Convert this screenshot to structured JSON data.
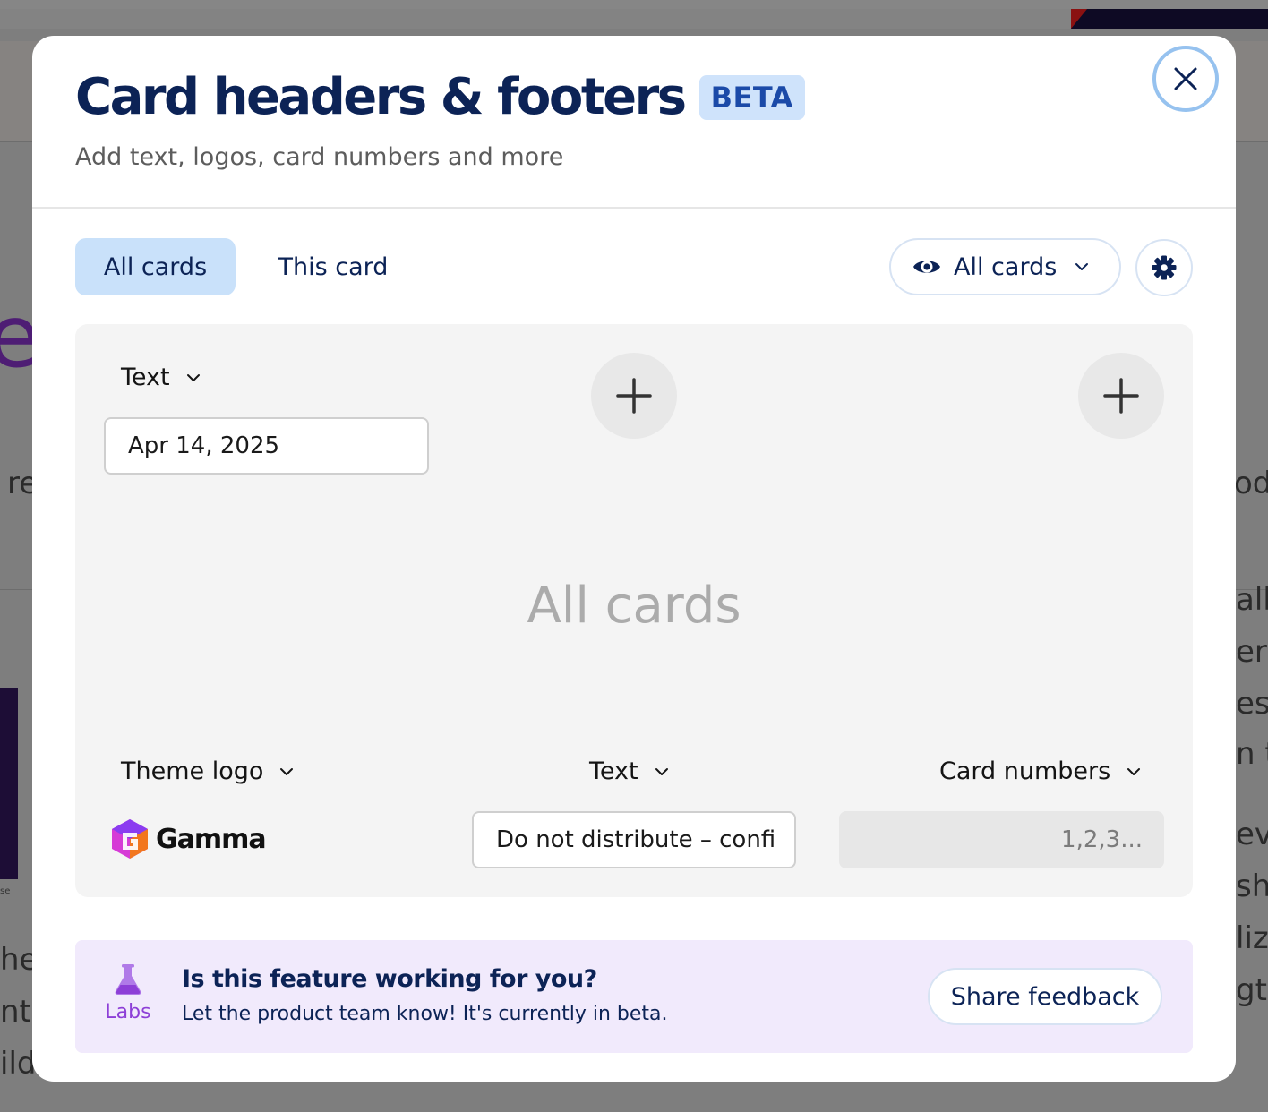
{
  "background": {
    "fragments": [
      "re",
      "od",
      "all",
      "er e",
      "es v",
      "n t",
      "eve",
      "ship",
      "lize",
      "gth",
      "he",
      "nt,",
      "ild"
    ],
    "tiny_text": "se"
  },
  "modal": {
    "title": "Card headers & footers",
    "badge": "BETA",
    "subtitle": "Add text, logos, card numbers and more",
    "close_icon": "close-icon"
  },
  "tabs": [
    {
      "label": "All cards",
      "selected": true
    },
    {
      "label": "This card",
      "selected": false
    }
  ],
  "view_select": {
    "icon": "eye-icon",
    "value": "All cards"
  },
  "settings": {
    "icon": "gear-icon"
  },
  "preview": {
    "center_label": "All cards",
    "header": {
      "left": {
        "type_label": "Text",
        "value": "Apr 14, 2025"
      },
      "center": {
        "icon": "plus-icon"
      },
      "right": {
        "icon": "plus-icon"
      }
    },
    "footer": {
      "left": {
        "type_label": "Theme logo",
        "logo_text": "Gamma"
      },
      "center": {
        "type_label": "Text",
        "value": "Do not distribute – confi"
      },
      "right": {
        "type_label": "Card numbers",
        "value": "1,2,3..."
      }
    }
  },
  "feedback": {
    "labs_label": "Labs",
    "title": "Is this feature working for you?",
    "description": "Let the product team know! It's currently in beta.",
    "button_label": "Share feedback"
  },
  "colors": {
    "primary_text": "#0c2356",
    "tab_selected_bg": "#c9e1fa",
    "beta_bg": "#cfe3fb",
    "labs_purple": "#8d3fd7",
    "feedback_bg": "#f1eafc",
    "close_ring": "#96c2ef"
  }
}
